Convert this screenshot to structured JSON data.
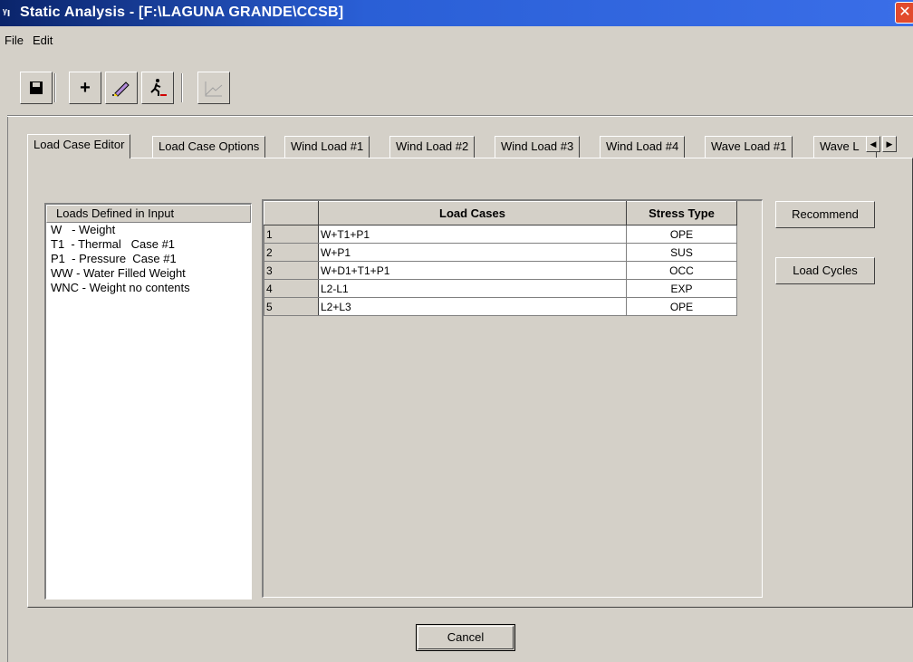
{
  "window": {
    "icon": "app-icon",
    "title": "Static Analysis - [F:\\LAGUNA GRANDE\\CCSB]",
    "close": "✕"
  },
  "menu": [
    "File",
    "Edit"
  ],
  "toolbar": {
    "save_icon": "save-icon",
    "add_glyph": "+",
    "edit_icon": "edit-pencil-icon",
    "run_icon": "run-icon",
    "plot_icon": "plot-icon"
  },
  "tabs": [
    "Load Case Editor",
    "Load Case Options",
    "Wind Load #1",
    "Wind Load #2",
    "Wind Load #3",
    "Wind Load #4",
    "Wave Load #1",
    "Wave L"
  ],
  "active_tab": "Load Case Editor",
  "loads_list": {
    "header": "Loads Defined in Input",
    "items": [
      "W   - Weight",
      "T1  - Thermal   Case #1",
      "P1  - Pressure  Case #1",
      "WW - Water Filled Weight",
      "WNC - Weight no contents"
    ]
  },
  "grid": {
    "headers": [
      "",
      "Load Cases",
      "Stress Type"
    ],
    "rows": [
      {
        "num": "1",
        "case": "W+T1+P1",
        "type": "OPE"
      },
      {
        "num": "2",
        "case": "W+P1",
        "type": "SUS"
      },
      {
        "num": "3",
        "case": "W+D1+T1+P1",
        "type": "OCC"
      },
      {
        "num": "4",
        "case": "L2-L1",
        "type": "EXP"
      },
      {
        "num": "5",
        "case": "L2+L3",
        "type": "OPE"
      }
    ]
  },
  "buttons": {
    "recommend": "Recommend",
    "load_cycles": "Load Cycles",
    "cancel": "Cancel"
  }
}
